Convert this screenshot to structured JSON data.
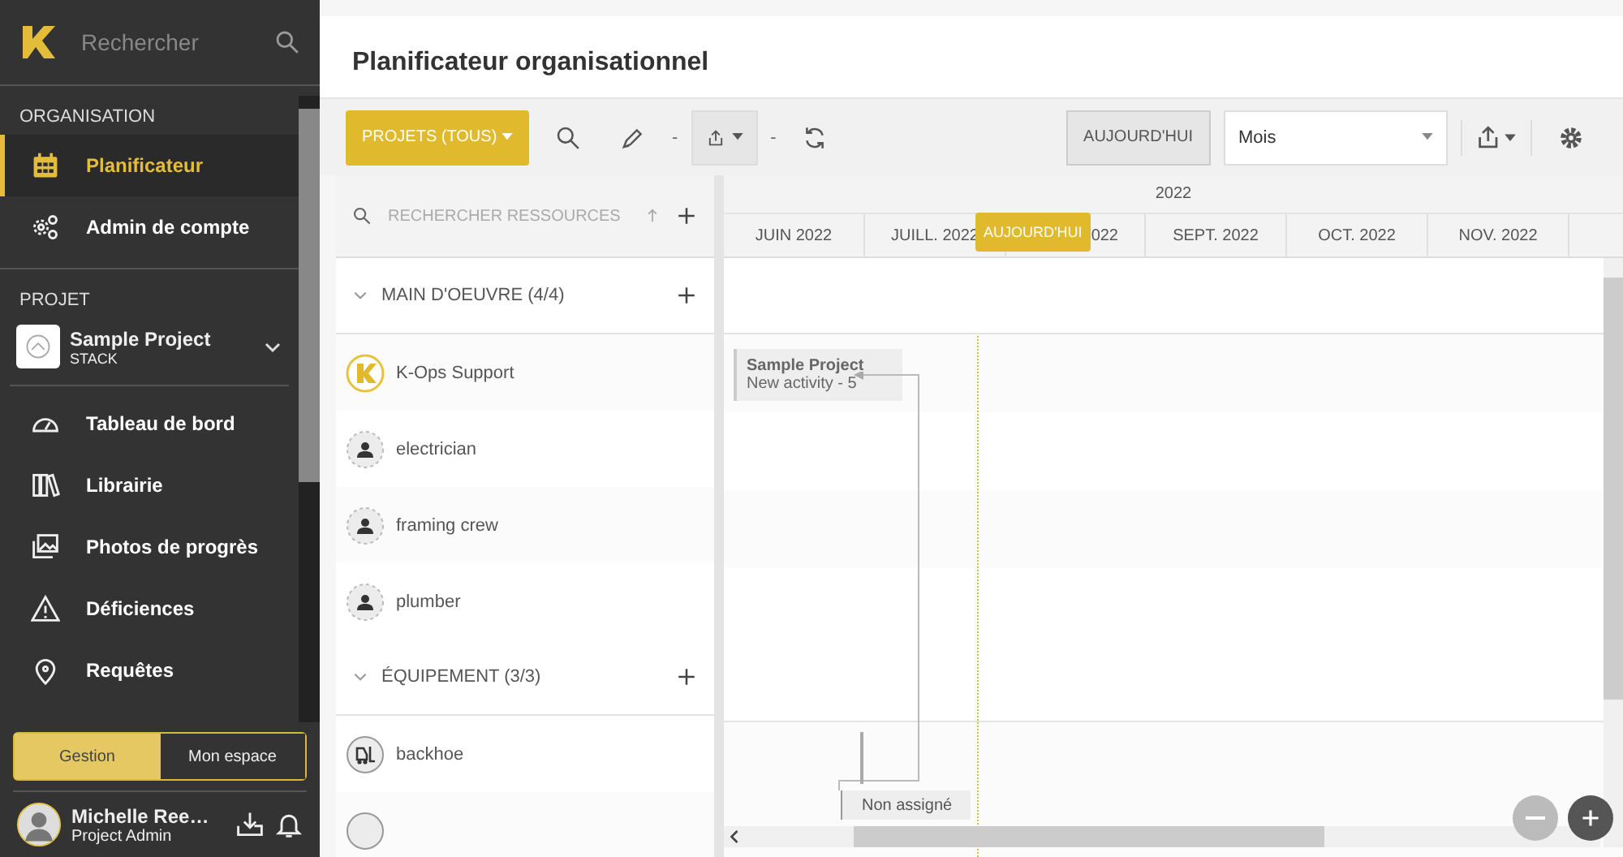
{
  "sidebar": {
    "search": {
      "placeholder": "Rechercher"
    },
    "org_heading": "ORGANISATION",
    "org_items": [
      {
        "label": "Planificateur",
        "selected": true
      },
      {
        "label": "Admin de compte",
        "selected": false
      }
    ],
    "project_heading": "PROJET",
    "project": {
      "name": "Sample Project",
      "subtitle": "STACK"
    },
    "project_items": [
      {
        "label": "Tableau de bord",
        "selected": false
      },
      {
        "label": "Librairie",
        "selected": false
      },
      {
        "label": "Photos de progrès",
        "selected": false
      },
      {
        "label": "Déficiences",
        "selected": false
      },
      {
        "label": "Requêtes",
        "selected": false
      }
    ],
    "mode_toggle": [
      {
        "label": "Gestion",
        "selected": true
      },
      {
        "label": "Mon espace",
        "selected": false
      }
    ],
    "user": {
      "name": "Michelle Ree…",
      "role": "Project Admin"
    }
  },
  "page_title": "Planificateur organisationnel",
  "toolbar": {
    "projects_button": "PROJETS (TOUS)",
    "separator_1": "-",
    "separator_2": "-",
    "today_button": "AUJOURD'HUI",
    "view_select": {
      "value": "Mois"
    }
  },
  "resources": {
    "search": {
      "placeholder": "RECHERCHER RESSOURCES"
    },
    "groups": [
      {
        "title": "MAIN D'OEUVRE (4/4)",
        "expanded": true,
        "items": [
          {
            "name": "K-Ops Support",
            "kind": "company"
          },
          {
            "name": "electrician",
            "kind": "person"
          },
          {
            "name": "framing crew",
            "kind": "person"
          },
          {
            "name": "plumber",
            "kind": "person"
          }
        ]
      },
      {
        "title": "ÉQUIPEMENT (3/3)",
        "expanded": true,
        "items": [
          {
            "name": "backhoe",
            "kind": "equipment"
          }
        ]
      }
    ]
  },
  "timeline": {
    "year": "2022",
    "months": [
      "JUIN 2022",
      "JUILL. 2022",
      "022",
      "SEPT. 2022",
      "OCT. 2022",
      "NOV. 2022"
    ],
    "today_label": "AUJOURD'HUI",
    "activity": {
      "project": "Sample Project",
      "name": "New activity - 5"
    },
    "unassigned": "Non assigné"
  }
}
